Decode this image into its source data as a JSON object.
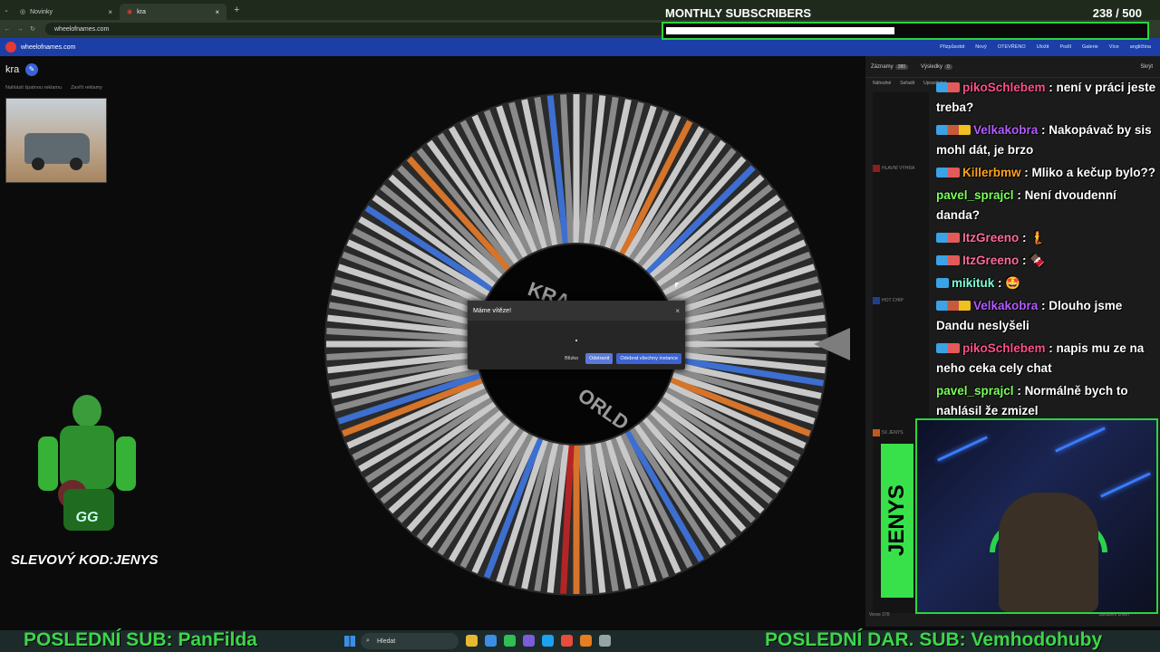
{
  "browser": {
    "tabs": [
      {
        "label": "Novinky"
      },
      {
        "label": "kra"
      }
    ],
    "url": "wheelofnames.com"
  },
  "site": {
    "name": "wheelofnames.com",
    "menu": [
      "Přizpůsobit",
      "Nový",
      "OTEVŘENO",
      "Uložit",
      "Podíl",
      "Galerie",
      "Více",
      "angličtina"
    ]
  },
  "page": {
    "title": "kra",
    "ad_links": [
      "Nahlásit špatnou reklamu",
      "Zavřít reklamy"
    ]
  },
  "dialog": {
    "title": "Máme vítěze!",
    "close": "×",
    "actions": [
      "Blízko",
      "Odstranit",
      "Odebrat všechny instance"
    ]
  },
  "wheel": {
    "center_text": [
      "KRA",
      "ORLD"
    ]
  },
  "sidebar": {
    "tabs": [
      {
        "label": "Záznamy",
        "badge": "380"
      },
      {
        "label": "Výsledky",
        "badge": "0"
      },
      {
        "label": "Skrýt"
      }
    ],
    "tools": [
      "Náhodné",
      "Seřadit",
      "Upravitelné"
    ],
    "entries": [
      {
        "label": "HLAVNÍ VÝHRA",
        "color": "#8b1e1e"
      },
      {
        "label": "HOT CHIP",
        "color": "#1e3f8b"
      },
      {
        "label": "5X JENYS",
        "color": "#c0581e"
      }
    ],
    "version": "Verze 378",
    "footer_link": "Sdružení změn"
  },
  "chat": [
    {
      "user": "pikoSchlebem",
      "color": "#ff4f8b",
      "badges": 2,
      "text": "není v práci jeste treba?"
    },
    {
      "user": "Velkakobra",
      "color": "#b25cff",
      "badges": 3,
      "text": "Nakopávač by sis mohl dát, je brzo"
    },
    {
      "user": "Killerbmw",
      "color": "#ffa41b",
      "badges": 2,
      "text": "Mliko a kečup bylo??"
    },
    {
      "user": "pavel_sprajcl",
      "color": "#7cff5a",
      "badges": 0,
      "text": "Není dvoudenní danda?"
    },
    {
      "user": "ItzGreeno",
      "color": "#ff6b9a",
      "badges": 2,
      "text": "🧜"
    },
    {
      "user": "ItzGreeno",
      "color": "#ff6b9a",
      "badges": 2,
      "text": "🍫"
    },
    {
      "user": "mikituk",
      "color": "#7cffd8",
      "badges": 1,
      "text": "🤩"
    },
    {
      "user": "Velkakobra",
      "color": "#b25cff",
      "badges": 3,
      "text": "Dlouho jsme Dandu neslyšeli"
    },
    {
      "user": "pikoSchlebem",
      "color": "#ff4f8b",
      "badges": 2,
      "text": "napis mu ze na neho ceka cely chat"
    },
    {
      "user": "pavel_sprajcl",
      "color": "#7cff5a",
      "badges": 0,
      "text": "Normálně bych to nahlásil že zmizel"
    }
  ],
  "overlay": {
    "monthly_title": "MONTHLY SUBSCRIBERS",
    "count": "238 / 500",
    "progress_fraction": 0.476,
    "promo_label": "SLEVOVÝ KOD:",
    "promo_code": "JENYS",
    "last_sub": "POSLEDNÍ SUB: PanFilda",
    "last_gift": "POSLEDNÍ DAR. SUB: Vemhodohuby",
    "logo_text": "JENYS"
  },
  "taskbar": {
    "search_placeholder": "Hledat"
  }
}
